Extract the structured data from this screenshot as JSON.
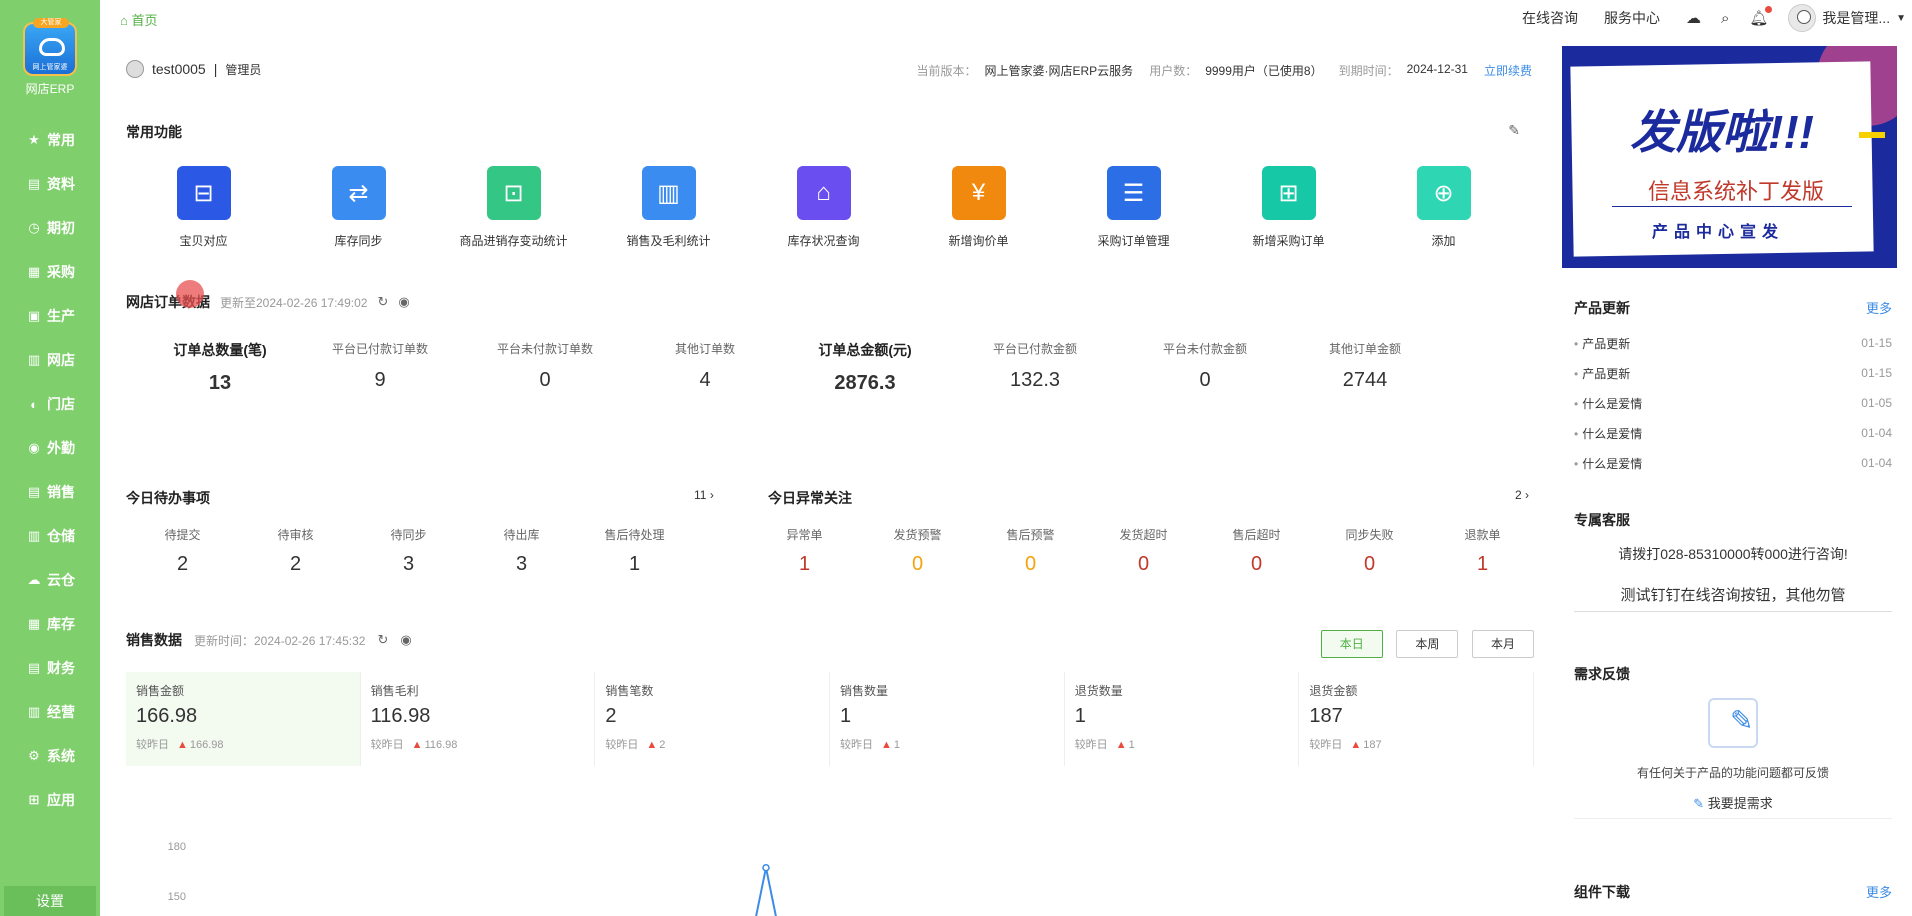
{
  "sidebar": {
    "logo_badge": "大管家",
    "logo_small": "网上管家婆",
    "app_name": "网店ERP",
    "items": [
      {
        "label": "常用",
        "icon": "star-icon"
      },
      {
        "label": "资料",
        "icon": "document-icon"
      },
      {
        "label": "期初",
        "icon": "clock-icon"
      },
      {
        "label": "采购",
        "icon": "cart-icon"
      },
      {
        "label": "生产",
        "icon": "factory-icon"
      },
      {
        "label": "网店",
        "icon": "shop-icon"
      },
      {
        "label": "门店",
        "icon": "store-icon"
      },
      {
        "label": "外勤",
        "icon": "location-icon"
      },
      {
        "label": "销售",
        "icon": "sales-icon"
      },
      {
        "label": "仓储",
        "icon": "warehouse-icon"
      },
      {
        "label": "云仓",
        "icon": "cloud-icon"
      },
      {
        "label": "库存",
        "icon": "inventory-icon"
      },
      {
        "label": "财务",
        "icon": "finance-icon"
      },
      {
        "label": "经营",
        "icon": "chart-icon"
      },
      {
        "label": "系统",
        "icon": "gear-icon"
      },
      {
        "label": "应用",
        "icon": "plus-square-icon"
      }
    ],
    "settings": "设置"
  },
  "topbar": {
    "home": "首页",
    "links": [
      "在线咨询",
      "服务中心"
    ],
    "user_name": "我是管理..."
  },
  "user": {
    "name": "test0005",
    "role": "管理员",
    "version_label": "当前版本：",
    "version": "网上管家婆·网店ERP云服务",
    "users_label": "用户数：",
    "users": "9999用户（已使用8）",
    "expire_label": "到期时间：",
    "expire": "2024-12-31",
    "renew": "立即续费"
  },
  "common": {
    "title": "常用功能",
    "items": [
      {
        "label": "宝贝对应",
        "color": "#2b59e6",
        "icon": "product-map-icon"
      },
      {
        "label": "库存同步",
        "color": "#3b8cf0",
        "icon": "sync-icon"
      },
      {
        "label": "商品进销存变动统计",
        "color": "#34c684",
        "icon": "cart-chart-icon"
      },
      {
        "label": "销售及毛利统计",
        "color": "#3b8cf0",
        "icon": "bar-chart-icon"
      },
      {
        "label": "库存状况查询",
        "color": "#6a4ef0",
        "icon": "search-home-icon"
      },
      {
        "label": "新增询价单",
        "color": "#f2890f",
        "icon": "quote-icon"
      },
      {
        "label": "采购订单管理",
        "color": "#2b6ee6",
        "icon": "order-manage-icon"
      },
      {
        "label": "新增采购订单",
        "color": "#17c8a6",
        "icon": "new-order-icon"
      },
      {
        "label": "添加",
        "color": "#2fd6b4",
        "icon": "add-icon"
      }
    ]
  },
  "orders": {
    "title": "网店订单数据",
    "update": "更新至2024-02-26 17:49:02",
    "stats": [
      {
        "label": "订单总数量(笔)",
        "value": "13",
        "big": true
      },
      {
        "label": "平台已付款订单数",
        "value": "9"
      },
      {
        "label": "平台未付款订单数",
        "value": "0"
      },
      {
        "label": "其他订单数",
        "value": "4"
      },
      {
        "label": "订单总金额(元)",
        "value": "2876.3",
        "big": true
      },
      {
        "label": "平台已付款金额",
        "value": "132.3"
      },
      {
        "label": "平台未付款金额",
        "value": "0"
      },
      {
        "label": "其他订单金额",
        "value": "2744"
      }
    ]
  },
  "todo": {
    "title": "今日待办事项",
    "count": "11",
    "items": [
      {
        "label": "待提交",
        "value": "2"
      },
      {
        "label": "待审核",
        "value": "2"
      },
      {
        "label": "待同步",
        "value": "3"
      },
      {
        "label": "待出库",
        "value": "3"
      },
      {
        "label": "售后待处理",
        "value": "1"
      }
    ]
  },
  "abnormal": {
    "title": "今日异常关注",
    "count": "2",
    "items": [
      {
        "label": "异常单",
        "value": "1",
        "color": "#c0392b"
      },
      {
        "label": "发货预警",
        "value": "0",
        "color": "#f2a30f"
      },
      {
        "label": "售后预警",
        "value": "0",
        "color": "#f2a30f"
      },
      {
        "label": "发货超时",
        "value": "0",
        "color": "#c0392b"
      },
      {
        "label": "售后超时",
        "value": "0",
        "color": "#c0392b"
      },
      {
        "label": "同步失败",
        "value": "0",
        "color": "#c0392b"
      },
      {
        "label": "退款单",
        "value": "1",
        "color": "#c0392b"
      }
    ]
  },
  "sales": {
    "title": "销售数据",
    "update": "更新时间：2024-02-26 17:45:32",
    "buttons": [
      "本日",
      "本周",
      "本月"
    ],
    "compare_label": "较昨日",
    "cards": [
      {
        "label": "销售金额",
        "value": "166.98",
        "delta": "166.98"
      },
      {
        "label": "销售毛利",
        "value": "116.98",
        "delta": "116.98"
      },
      {
        "label": "销售笔数",
        "value": "2",
        "delta": "2"
      },
      {
        "label": "销售数量",
        "value": "1",
        "delta": "1"
      },
      {
        "label": "退货数量",
        "value": "1",
        "delta": "1"
      },
      {
        "label": "退货金额",
        "value": "187",
        "delta": "187"
      }
    ]
  },
  "chart_data": {
    "type": "line",
    "yticks": [
      "180",
      "150",
      "120"
    ],
    "ylim": [
      120,
      180
    ],
    "peak": 166.98
  },
  "banner": {
    "headline": "发版啦!!!",
    "sub": "信息系统补丁发版",
    "sub2": "产品中心宣发"
  },
  "news": {
    "title": "产品更新",
    "more": "更多",
    "items": [
      {
        "title": "产品更新",
        "date": "01-15"
      },
      {
        "title": "产品更新",
        "date": "01-15"
      },
      {
        "title": "什么是爱情",
        "date": "01-05"
      },
      {
        "title": "什么是爱情",
        "date": "01-04"
      },
      {
        "title": "什么是爱情",
        "date": "01-04"
      }
    ]
  },
  "service": {
    "title": "专属客服",
    "text": "请拨打028-85310000转000进行咨询!",
    "button": "测试钉钉在线咨询按钮，其他勿管"
  },
  "feedback": {
    "title": "需求反馈",
    "text": "有任何关于产品的功能问题都可反馈",
    "button": "我要提需求"
  },
  "download": {
    "title": "组件下载",
    "more": "更多"
  }
}
